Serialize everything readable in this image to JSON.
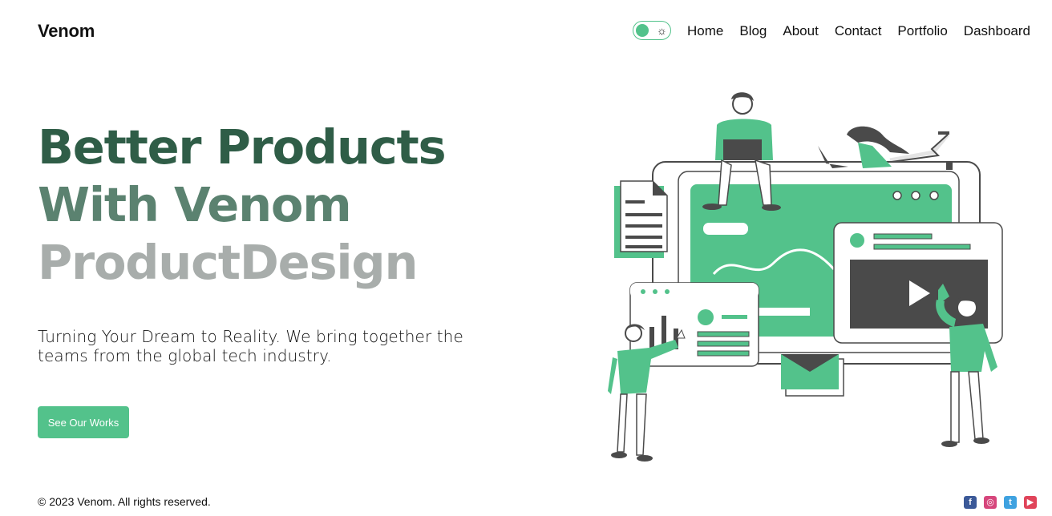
{
  "brand": {
    "name": "Venom"
  },
  "theme_toggle": {
    "icon": "sun-icon",
    "icon_glyph": "☼"
  },
  "nav": {
    "items": [
      {
        "label": "Home"
      },
      {
        "label": "Blog"
      },
      {
        "label": "About"
      },
      {
        "label": "Contact"
      },
      {
        "label": "Portfolio"
      },
      {
        "label": "Dashboard"
      }
    ]
  },
  "hero": {
    "title_line1": "Better Products",
    "title_line2": "With Venom",
    "title_line3": "ProductDesign",
    "description": "Turning Your Dream to Reality. We bring together the teams from the global tech industry.",
    "cta_label": "See Our Works"
  },
  "footer": {
    "copyright": "© 2023 Venom. All rights reserved.",
    "socials": [
      {
        "icon": "facebook-icon",
        "glyph": "f",
        "color": "#3b5998"
      },
      {
        "icon": "instagram-icon",
        "glyph": "◎",
        "color": "#d6467c"
      },
      {
        "icon": "twitter-icon",
        "glyph": "t",
        "color": "#3fa2e0"
      },
      {
        "icon": "youtube-icon",
        "glyph": "▶",
        "color": "#e0445a"
      }
    ]
  },
  "colors": {
    "accent": "#53c28b",
    "title_dark": "#2f5d47",
    "title_mid": "#5b8270",
    "title_light": "#a8adab",
    "illustration_dark": "#4a4a4a"
  }
}
